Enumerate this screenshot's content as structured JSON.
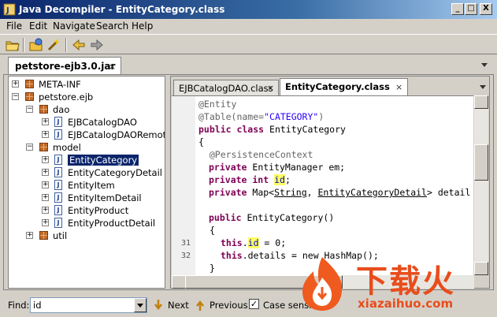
{
  "window": {
    "title": "Java Decompiler - EntityCategory.class",
    "minimize": "_",
    "maximize": "□",
    "close": "X"
  },
  "menu": [
    "File",
    "Edit",
    "Navigate",
    "Search",
    "Help"
  ],
  "toolbar": {
    "icons": [
      "open-folder-icon",
      "open-type-icon",
      "wand-icon",
      "back-arrow-icon",
      "forward-arrow-icon"
    ]
  },
  "outer_tab": {
    "label": "petstore-ejb3.0.jar",
    "close": "×"
  },
  "tree": {
    "meta_inf": "META-INF",
    "root": "petstore.ejb",
    "dao": "dao",
    "dao_items": [
      "EJBCatalogDAO",
      "EJBCatalogDAORemote"
    ],
    "model": "model",
    "model_items": [
      "EntityCategory",
      "EntityCategoryDetail",
      "EntityItem",
      "EntityItemDetail",
      "EntityProduct",
      "EntityProductDetail"
    ],
    "util": "util",
    "selected": "EntityCategory"
  },
  "editor_tabs": [
    {
      "label": "EJBCatalogDAO.class",
      "close": "×"
    },
    {
      "label": "EntityCategory.class",
      "close": "×"
    }
  ],
  "code": {
    "line1": "@Entity",
    "line2_a": "@Table(name=",
    "line2_str": "\"CATEGORY\"",
    "line2_b": ")",
    "line3_kw": "public class",
    "line3_rest": " EntityCategory",
    "line4": "{",
    "line5": "  @PersistenceContext",
    "line6_kw": "private",
    "line6_rest": " EntityManager em;",
    "line7_kw": "private int",
    "line7_fld": "id",
    "line7_end": ";",
    "line8_kw": "private",
    "line8_a": " Map<",
    "line8_type1": "String",
    "line8_b": ", ",
    "line8_type2": "EntityCategoryDetail",
    "line8_c": "> detail",
    "line10_kw": "public",
    "line10_rest": " EntityCategory()",
    "line11": "{",
    "line12_kw": "this",
    "line12_a": ".",
    "line12_fld": "id",
    "line12_b": " = 0;",
    "line13_kw": "this",
    "line13_rest": ".details = new HashMap();",
    "line14": "}",
    "line_numbers": [
      "31",
      "32"
    ]
  },
  "find": {
    "label": "Find:",
    "value": "id",
    "next": "Next",
    "previous": "Previous",
    "case_checked": "✓",
    "case_label": "Case sensitive"
  },
  "watermark": {
    "text": "下载火",
    "url": "xiazaihuo.com"
  }
}
